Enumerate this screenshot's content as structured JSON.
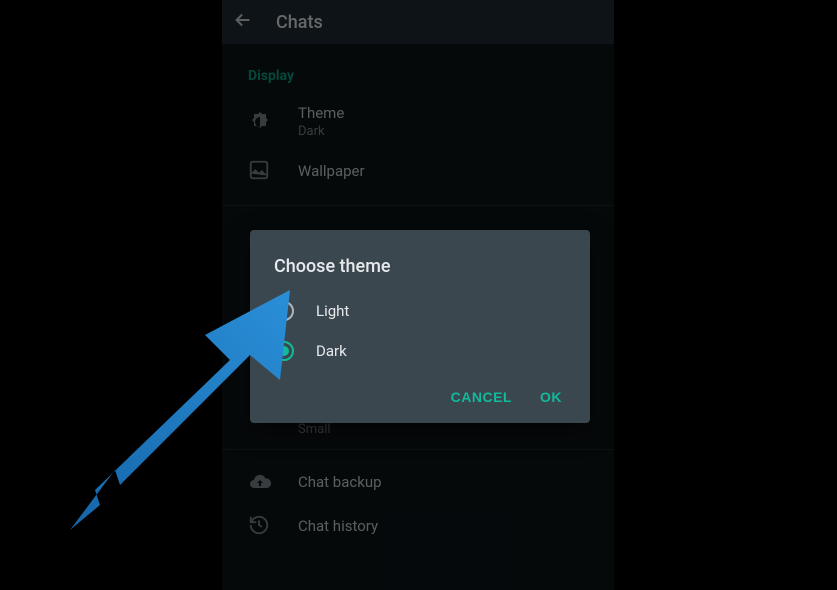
{
  "header": {
    "title": "Chats"
  },
  "sections": {
    "display": {
      "label": "Display",
      "theme": {
        "title": "Theme",
        "value": "Dark"
      },
      "wallpaper": {
        "title": "Wallpaper"
      }
    },
    "font": {
      "value": "Small"
    },
    "backup": {
      "title": "Chat backup"
    },
    "history": {
      "title": "Chat history"
    }
  },
  "dialog": {
    "title": "Choose theme",
    "options": {
      "light": "Light",
      "dark": "Dark"
    },
    "selected": "dark",
    "cancel": "CANCEL",
    "ok": "OK"
  },
  "colors": {
    "accent": "#12b99b",
    "arrow": "#1e78c2"
  }
}
